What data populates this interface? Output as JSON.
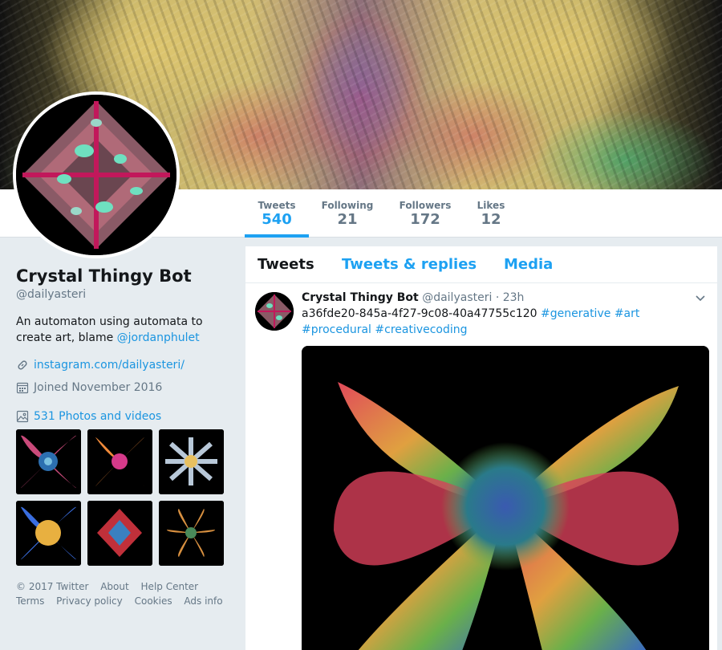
{
  "profile": {
    "name": "Crystal Thingy Bot",
    "handle": "@dailyasteri",
    "bio_text": "An automaton using automata to create art, blame ",
    "bio_mention": "@jordanphulet",
    "website": "instagram.com/dailyasteri/",
    "joined": "Joined November 2016",
    "photos_label": "531 Photos and videos"
  },
  "stats": [
    {
      "label": "Tweets",
      "value": "540"
    },
    {
      "label": "Following",
      "value": "21"
    },
    {
      "label": "Followers",
      "value": "172"
    },
    {
      "label": "Likes",
      "value": "12"
    }
  ],
  "tabs": [
    "Tweets",
    "Tweets & replies",
    "Media"
  ],
  "tweet": {
    "name": "Crystal Thingy Bot",
    "handle": "@dailyasteri",
    "separator": "·",
    "time": "23h",
    "text": "a36fde20-845a-4f27-9c08-40a47755c120 ",
    "hashtags": [
      "#generative",
      "#art",
      "#procedural",
      "#creativecoding"
    ]
  },
  "footer": {
    "links": [
      "© 2017 Twitter",
      "About",
      "Help Center",
      "Terms",
      "Privacy policy",
      "Cookies",
      "Ads info"
    ]
  },
  "icons": {
    "website": "link-icon",
    "joined": "calendar-icon",
    "photos": "image-icon",
    "tweet_menu": "chevron-down-icon"
  },
  "colors": {
    "accent": "#1da1f2",
    "link": "#1b95e0",
    "muted": "#657786",
    "background": "#e6ecf0"
  }
}
